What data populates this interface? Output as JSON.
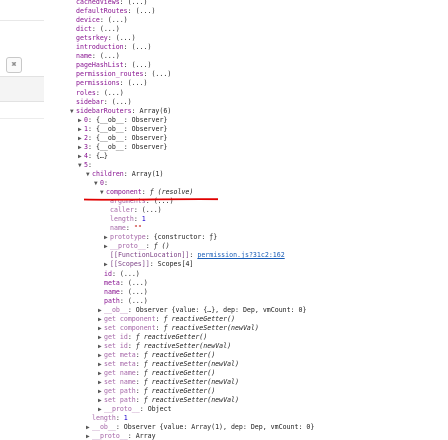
{
  "console": {
    "lines": [
      {
        "indent": 76,
        "arrow": "",
        "key": "defaultRoutes",
        "sep": ": ",
        "value": "(...)",
        "kc": "k",
        "vc": "v",
        "cut": true,
        "prefix_key": "cachedViews"
      },
      {
        "indent": 76,
        "arrow": "",
        "key": "defaultRoutes",
        "sep": ": ",
        "value": "(...)",
        "kc": "k",
        "vc": "v"
      },
      {
        "indent": 76,
        "arrow": "",
        "key": "device",
        "sep": ": ",
        "value": "(...)",
        "kc": "k",
        "vc": "v"
      },
      {
        "indent": 76,
        "arrow": "",
        "key": "dict",
        "sep": ": ",
        "value": "(...)",
        "kc": "k",
        "vc": "v"
      },
      {
        "indent": 76,
        "arrow": "",
        "key": "getsrkey",
        "sep": ": ",
        "value": "(...)",
        "kc": "k",
        "vc": "v"
      },
      {
        "indent": 76,
        "arrow": "",
        "key": "introduction",
        "sep": ": ",
        "value": "(...)",
        "kc": "k",
        "vc": "v"
      },
      {
        "indent": 76,
        "arrow": "",
        "key": "name",
        "sep": ": ",
        "value": "(...)",
        "kc": "k",
        "vc": "v"
      },
      {
        "indent": 76,
        "arrow": "",
        "key": "pageHashList",
        "sep": ": ",
        "value": "(...)",
        "kc": "k",
        "vc": "v"
      },
      {
        "indent": 76,
        "arrow": "",
        "key": "permission_routes",
        "sep": ": ",
        "value": "(...)",
        "kc": "k",
        "vc": "v"
      },
      {
        "indent": 76,
        "arrow": "",
        "key": "permissions",
        "sep": ": ",
        "value": "(...)",
        "kc": "k",
        "vc": "v"
      },
      {
        "indent": 76,
        "arrow": "",
        "key": "roles",
        "sep": ": ",
        "value": "(...)",
        "kc": "k",
        "vc": "v"
      },
      {
        "indent": 76,
        "arrow": "",
        "key": "sidebar",
        "sep": ": ",
        "value": "(...)",
        "kc": "k",
        "vc": "v"
      },
      {
        "indent": 70,
        "arrow": "▼",
        "key": "sidebarRouters",
        "sep": ": ",
        "value": "Array(6)",
        "kc": "k",
        "vc": "v"
      },
      {
        "indent": 78,
        "arrow": "▶",
        "key": "0",
        "sep": ": ",
        "value": "{__ob__: Observer}",
        "kc": "k",
        "vc": "v"
      },
      {
        "indent": 78,
        "arrow": "▶",
        "key": "1",
        "sep": ": ",
        "value": "{__ob__: Observer}",
        "kc": "k",
        "vc": "v"
      },
      {
        "indent": 78,
        "arrow": "▶",
        "key": "2",
        "sep": ": ",
        "value": "{__ob__: Observer}",
        "kc": "k",
        "vc": "v"
      },
      {
        "indent": 78,
        "arrow": "▶",
        "key": "3",
        "sep": ": ",
        "value": "{__ob__: Observer}",
        "kc": "k",
        "vc": "v"
      },
      {
        "indent": 78,
        "arrow": "▶",
        "key": "4",
        "sep": ": ",
        "value": "{…}",
        "kc": "k",
        "vc": "v"
      },
      {
        "indent": 78,
        "arrow": "▼",
        "key": "5",
        "sep": ":",
        "value": "",
        "kc": "k",
        "vc": "v"
      },
      {
        "indent": 86,
        "arrow": "▼",
        "key": "children",
        "sep": ": ",
        "value": "Array(1)",
        "kc": "k",
        "vc": "v"
      },
      {
        "indent": 94,
        "arrow": "▼",
        "key": "0",
        "sep": ":",
        "value": "",
        "kc": "k",
        "vc": "v"
      },
      {
        "indent": 100,
        "arrow": "▼",
        "key": "component",
        "sep": ": ",
        "value": "ƒ (resolve)",
        "kc": "k",
        "vc": "vi"
      },
      {
        "indent": 110,
        "arrow": "",
        "key": "arguments",
        "sep": ": ",
        "value": "(...)",
        "kc": "kl",
        "vc": "v"
      },
      {
        "indent": 110,
        "arrow": "",
        "key": "caller",
        "sep": ": ",
        "value": "(...)",
        "kc": "kl",
        "vc": "v"
      },
      {
        "indent": 110,
        "arrow": "",
        "key": "length",
        "sep": ": ",
        "value": "1",
        "kc": "kl",
        "vc": "vb"
      },
      {
        "indent": 110,
        "arrow": "",
        "key": "name",
        "sep": ": ",
        "value": "\"\"",
        "kc": "kl",
        "vc": "vs"
      },
      {
        "indent": 104,
        "arrow": "▶",
        "key": "prototype",
        "sep": ": ",
        "value": "{constructor: ƒ}",
        "kc": "kl",
        "vc": "v"
      },
      {
        "indent": 104,
        "arrow": "▶",
        "key": "__proto__",
        "sep": ": ",
        "value": "ƒ ()",
        "kc": "kl",
        "vc": "vi"
      },
      {
        "indent": 110,
        "arrow": "",
        "key": "[[FunctionLocation]]",
        "sep": ": ",
        "value": "permission.js?31c2:162",
        "kc": "kg",
        "vc": "link"
      },
      {
        "indent": 104,
        "arrow": "▶",
        "key": "[[Scopes]]",
        "sep": ": ",
        "value": "Scopes[4]",
        "kc": "kg",
        "vc": "v"
      },
      {
        "indent": 104,
        "arrow": "",
        "key": "id",
        "sep": ": ",
        "value": "(...)",
        "kc": "k",
        "vc": "v"
      },
      {
        "indent": 104,
        "arrow": "",
        "key": "meta",
        "sep": ": ",
        "value": "(...)",
        "kc": "k",
        "vc": "v"
      },
      {
        "indent": 104,
        "arrow": "",
        "key": "name",
        "sep": ": ",
        "value": "(...)",
        "kc": "k",
        "vc": "v"
      },
      {
        "indent": 104,
        "arrow": "",
        "key": "path",
        "sep": ": ",
        "value": "(...)",
        "kc": "k",
        "vc": "v"
      },
      {
        "indent": 98,
        "arrow": "▶",
        "key": "__ob__",
        "sep": ": ",
        "value": "Observer {value: {…}, dep: Dep, vmCount: 0}",
        "kc": "kl",
        "vc": "v"
      },
      {
        "indent": 98,
        "arrow": "▶",
        "key": "get component",
        "sep": ": ",
        "value": "ƒ reactiveGetter()",
        "kc": "kl",
        "vc": "vi"
      },
      {
        "indent": 98,
        "arrow": "▶",
        "key": "set component",
        "sep": ": ",
        "value": "ƒ reactiveSetter(newVal)",
        "kc": "kl",
        "vc": "vi"
      },
      {
        "indent": 98,
        "arrow": "▶",
        "key": "get id",
        "sep": ": ",
        "value": "ƒ reactiveGetter()",
        "kc": "kl",
        "vc": "vi"
      },
      {
        "indent": 98,
        "arrow": "▶",
        "key": "set id",
        "sep": ": ",
        "value": "ƒ reactiveSetter(newVal)",
        "kc": "kl",
        "vc": "vi"
      },
      {
        "indent": 98,
        "arrow": "▶",
        "key": "get meta",
        "sep": ": ",
        "value": "ƒ reactiveGetter()",
        "kc": "kl",
        "vc": "vi"
      },
      {
        "indent": 98,
        "arrow": "▶",
        "key": "set meta",
        "sep": ": ",
        "value": "ƒ reactiveSetter(newVal)",
        "kc": "kl",
        "vc": "vi"
      },
      {
        "indent": 98,
        "arrow": "▶",
        "key": "get name",
        "sep": ": ",
        "value": "ƒ reactiveGetter()",
        "kc": "kl",
        "vc": "vi"
      },
      {
        "indent": 98,
        "arrow": "▶",
        "key": "set name",
        "sep": ": ",
        "value": "ƒ reactiveSetter(newVal)",
        "kc": "kl",
        "vc": "vi"
      },
      {
        "indent": 98,
        "arrow": "▶",
        "key": "get path",
        "sep": ": ",
        "value": "ƒ reactiveGetter()",
        "kc": "kl",
        "vc": "vi"
      },
      {
        "indent": 98,
        "arrow": "▶",
        "key": "set path",
        "sep": ": ",
        "value": "ƒ reactiveSetter(newVal)",
        "kc": "kl",
        "vc": "vi"
      },
      {
        "indent": 98,
        "arrow": "▶",
        "key": "__proto__",
        "sep": ": ",
        "value": "Object",
        "kc": "kl",
        "vc": "v"
      },
      {
        "indent": 92,
        "arrow": "",
        "key": "length",
        "sep": ": ",
        "value": "1",
        "kc": "kl",
        "vc": "vb"
      },
      {
        "indent": 86,
        "arrow": "▶",
        "key": "__ob__",
        "sep": ": ",
        "value": "Observer {value: Array(1), dep: Dep, vmCount: 0}",
        "kc": "kl",
        "vc": "v"
      },
      {
        "indent": 86,
        "arrow": "▶",
        "key": "__proto__",
        "sep": ": ",
        "value": "Array",
        "kc": "kl",
        "vc": "v"
      }
    ]
  },
  "annotation": {
    "underline_color": "#e00000"
  },
  "left_panel": {
    "icon": "⌘"
  }
}
